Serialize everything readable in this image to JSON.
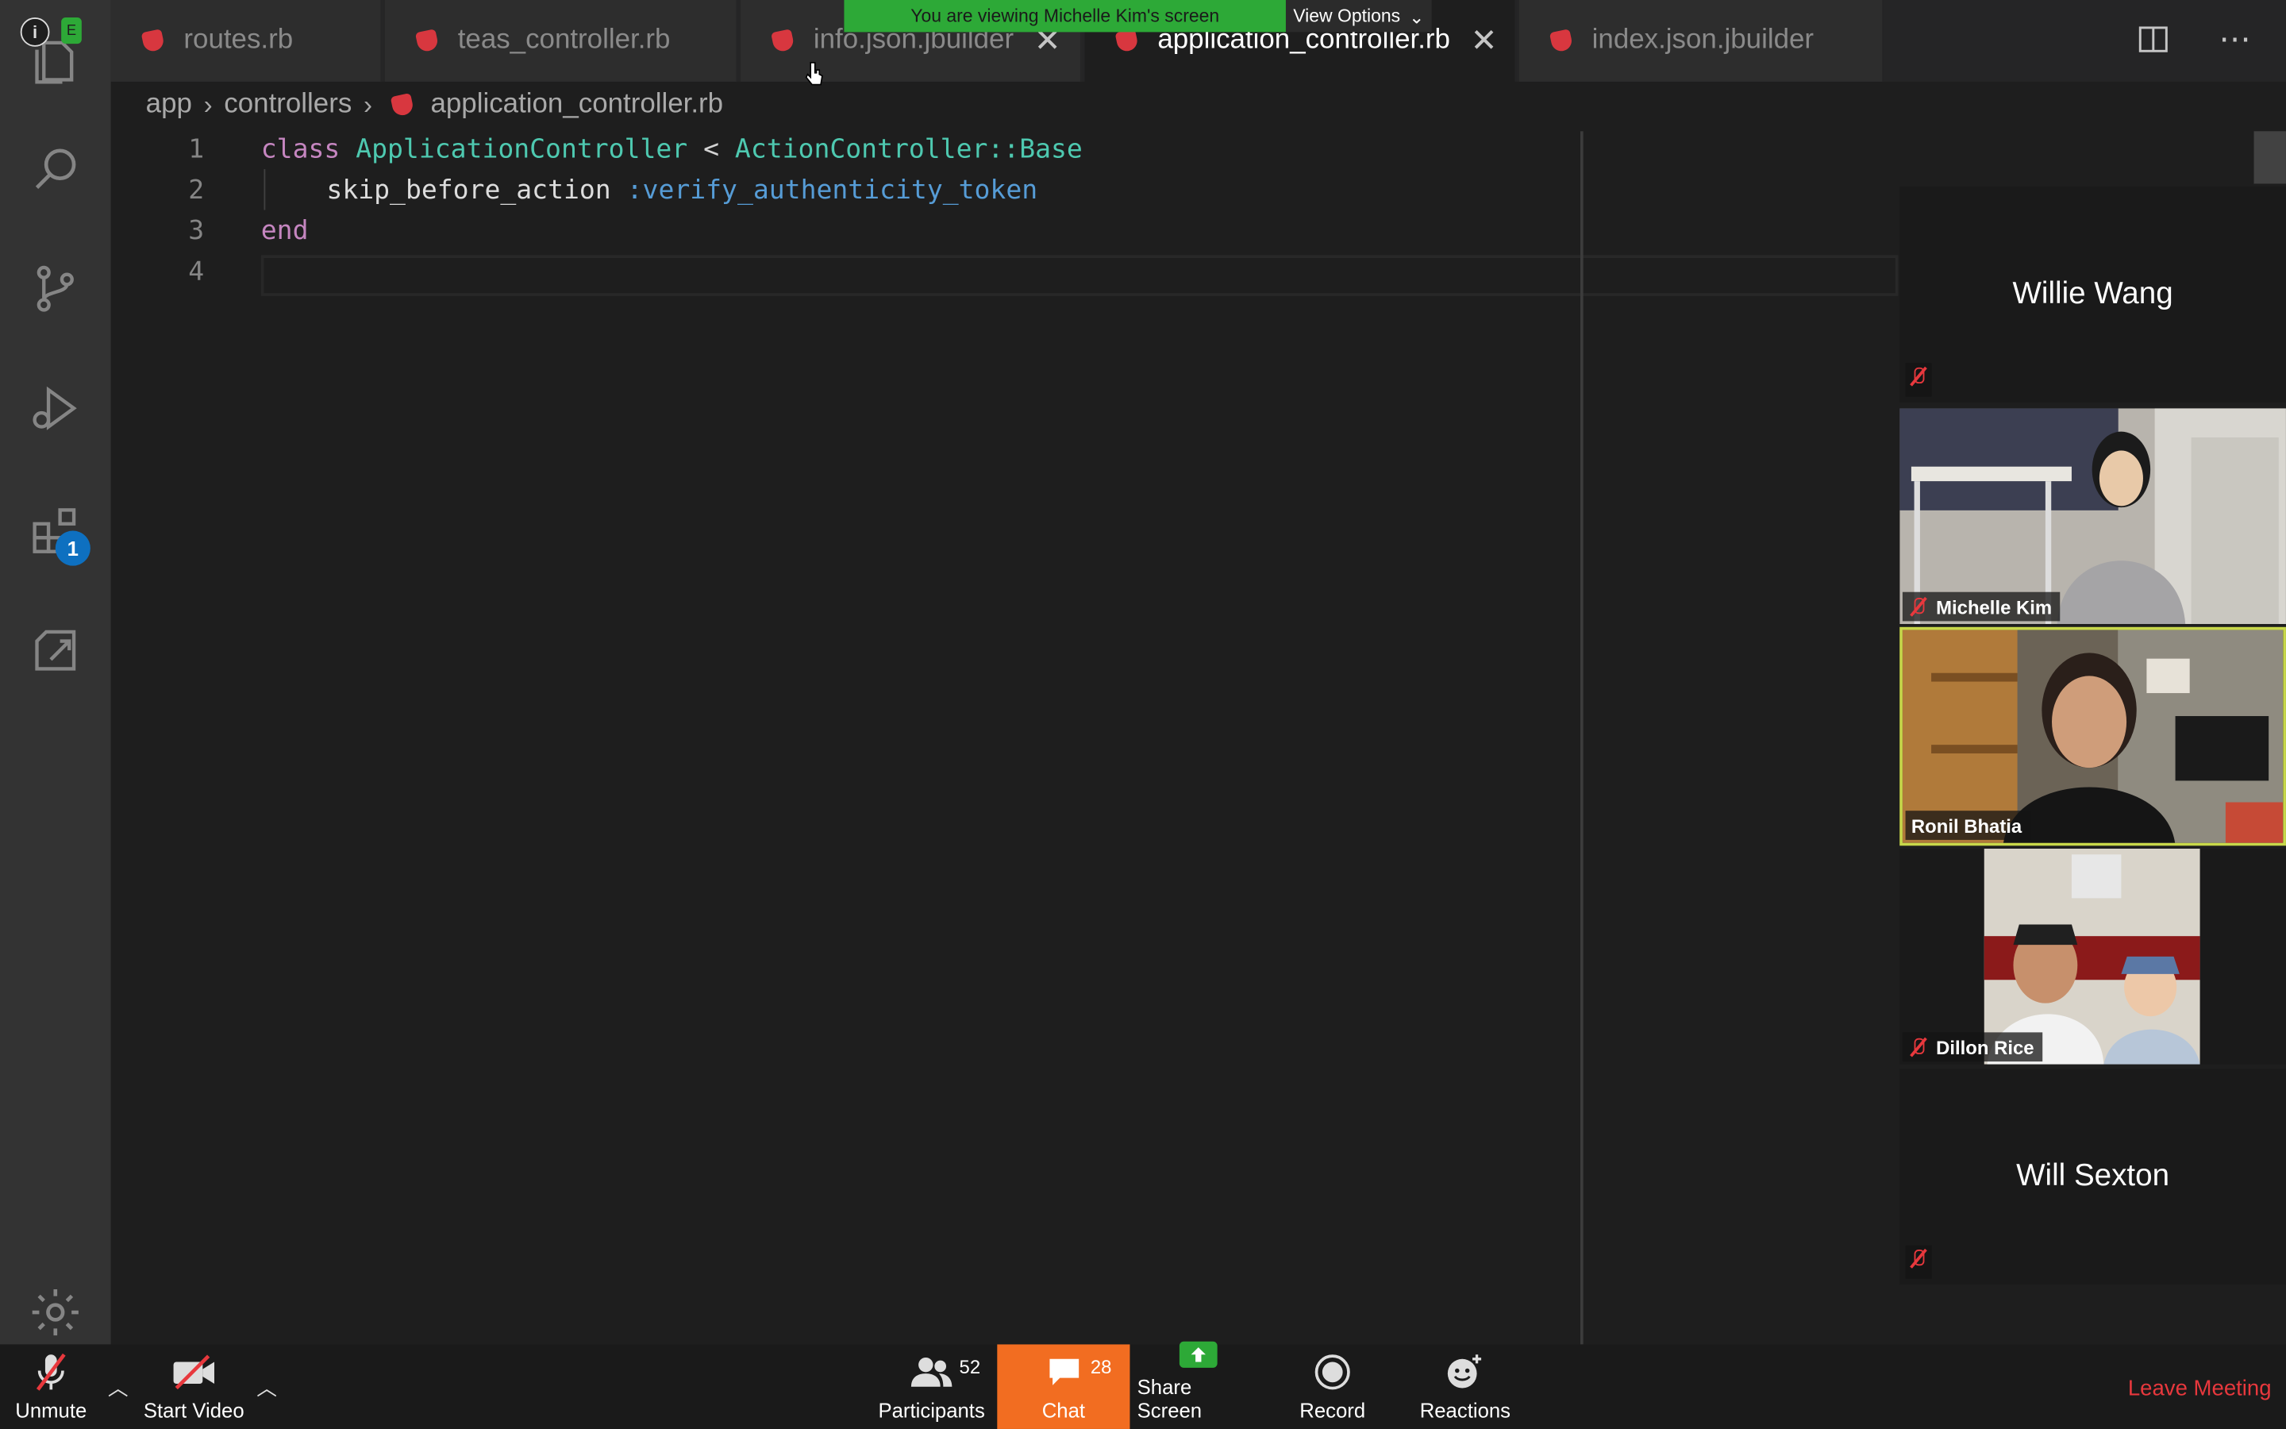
{
  "banner": {
    "viewing_text": "You are viewing Michelle Kim's screen",
    "view_options": "View Options"
  },
  "tabs": [
    {
      "label": "routes.rb",
      "active": false
    },
    {
      "label": "teas_controller.rb",
      "active": false
    },
    {
      "label": "info.json.jbuilder",
      "active": false,
      "close": "✕"
    },
    {
      "label": "application_controller.rb",
      "active": true,
      "close": "✕"
    },
    {
      "label": "index.json.jbuilder",
      "active": false
    }
  ],
  "breadcrumb": {
    "parts": [
      "app",
      "controllers",
      "application_controller.rb"
    ]
  },
  "activity_bar": {
    "extensions_badge": "1"
  },
  "editor": {
    "line_numbers": [
      "1",
      "2",
      "3",
      "4"
    ],
    "line1": {
      "kw": "class",
      "cls": "ApplicationController",
      "op": " < ",
      "base": "ActionController::Base"
    },
    "line2": {
      "ident": "skip_before_action",
      "sym": ":verify_authenticity_token"
    },
    "line3": {
      "kw": "end"
    }
  },
  "participants_panel": {
    "tiles": [
      {
        "name": "Willie Wang",
        "video": false,
        "muted": true
      },
      {
        "name": "Michelle Kim",
        "video": true,
        "muted": true
      },
      {
        "name": "Ronil Bhatia",
        "video": true,
        "muted": false,
        "active_speaker": true
      },
      {
        "name": "Dillon Rice",
        "video": true,
        "muted": true
      },
      {
        "name": "Will Sexton",
        "video": false,
        "muted": true
      }
    ]
  },
  "toolbar": {
    "unmute": "Unmute",
    "start_video": "Start Video",
    "participants": "Participants",
    "participants_count": "52",
    "chat": "Chat",
    "chat_count": "28",
    "share_screen": "Share Screen",
    "record": "Record",
    "reactions": "Reactions",
    "leave": "Leave Meeting"
  },
  "colors": {
    "share_green": "#2da937",
    "chat_orange": "#f26d21",
    "leave_red": "#e8383d",
    "speaker_highlight": "#c8d84a"
  }
}
